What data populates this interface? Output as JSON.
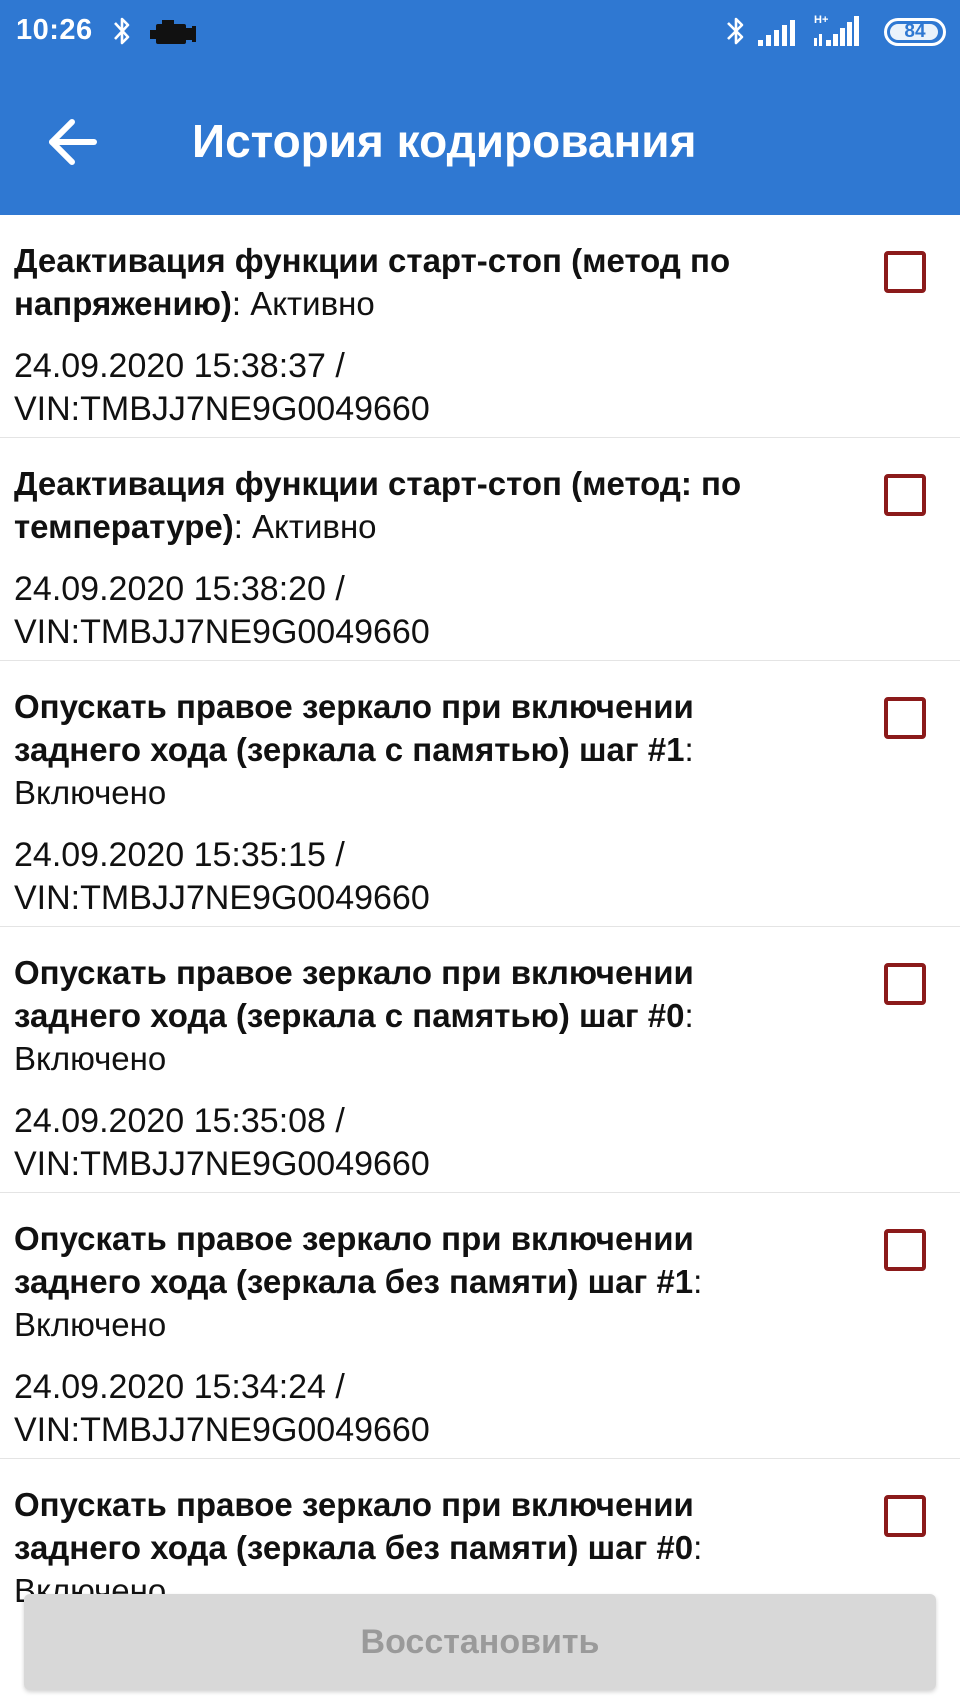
{
  "status_bar": {
    "time": "10:26",
    "battery": "84",
    "icons": [
      "bluetooth-icon",
      "engine-icon",
      "bluetooth-icon",
      "signal-icon",
      "signal-h-plus-icon",
      "battery-icon"
    ]
  },
  "app_bar": {
    "title": "История кодирования",
    "back_icon": "arrow-back-icon"
  },
  "colors": {
    "primary": "#2f78d2",
    "checkbox_border": "#8b1a1a",
    "button_disabled_bg": "#d8d8d8",
    "button_disabled_text": "#9a9a9a"
  },
  "items": [
    {
      "name": "Деактивация функции старт-стоп (метод по напряжению)",
      "status": ": Активно",
      "timestamp": "24.09.2020 15:38:37 /",
      "vin": "VIN:TMBJJ7NE9G0049660",
      "checked": false
    },
    {
      "name": "Деактивация функции старт-стоп (метод: по температуре)",
      "status": ": Активно",
      "timestamp": "24.09.2020 15:38:20 /",
      "vin": "VIN:TMBJJ7NE9G0049660",
      "checked": false
    },
    {
      "name": "Опускать правое зеркало при включении заднего хода (зеркала с памятью) шаг #1",
      "status": ": Включено",
      "timestamp": "24.09.2020 15:35:15 /",
      "vin": "VIN:TMBJJ7NE9G0049660",
      "checked": false
    },
    {
      "name": "Опускать правое зеркало при включении заднего хода (зеркала с памятью) шаг #0",
      "status": ": Включено",
      "timestamp": "24.09.2020 15:35:08 /",
      "vin": "VIN:TMBJJ7NE9G0049660",
      "checked": false
    },
    {
      "name": "Опускать правое зеркало при включении заднего хода (зеркала без памяти) шаг #1",
      "status": ": Включено",
      "timestamp": "24.09.2020 15:34:24 /",
      "vin": "VIN:TMBJJ7NE9G0049660",
      "checked": false
    },
    {
      "name": "Опускать правое зеркало при включении заднего хода (зеркала без памяти) шаг #0",
      "status": ": Включено"
    }
  ],
  "restore_button": {
    "label": "Восстановить",
    "enabled": false
  }
}
